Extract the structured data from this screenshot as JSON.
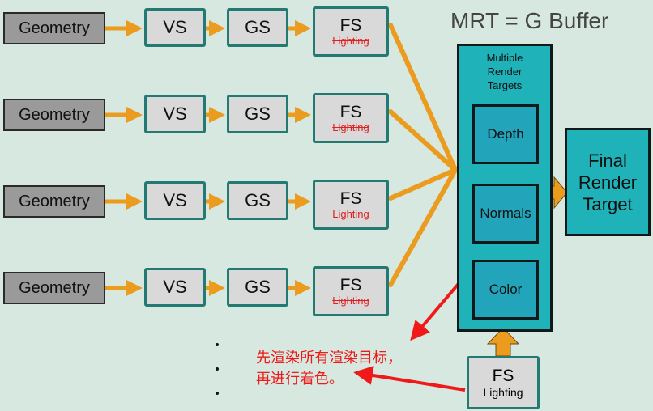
{
  "heading": "MRT = G Buffer",
  "rows": [
    {
      "geometry": "Geometry",
      "vs": "VS",
      "gs": "GS",
      "fs": "FS",
      "fs_sub": "Lighting"
    },
    {
      "geometry": "Geometry",
      "vs": "VS",
      "gs": "GS",
      "fs": "FS",
      "fs_sub": "Lighting"
    },
    {
      "geometry": "Geometry",
      "vs": "VS",
      "gs": "GS",
      "fs": "FS",
      "fs_sub": "Lighting"
    },
    {
      "geometry": "Geometry",
      "vs": "VS",
      "gs": "GS",
      "fs": "FS",
      "fs_sub": "Lighting"
    }
  ],
  "mrt": {
    "title_lines": [
      "Multiple",
      "Render",
      "Targets"
    ],
    "targets": [
      "Depth",
      "Normals",
      "Color"
    ]
  },
  "final": {
    "lines": [
      "Final",
      "Render",
      "Target"
    ]
  },
  "lighting_pass": {
    "label": "FS",
    "sub": "Lighting"
  },
  "annotation": {
    "lines": [
      "先渲染所有渲染目标，",
      "再进行着色。"
    ]
  },
  "colors": {
    "arrow": "#eb9b1e",
    "teal": "#1fb2b8",
    "stage_border": "#227a72",
    "annotation": "#f01818"
  }
}
